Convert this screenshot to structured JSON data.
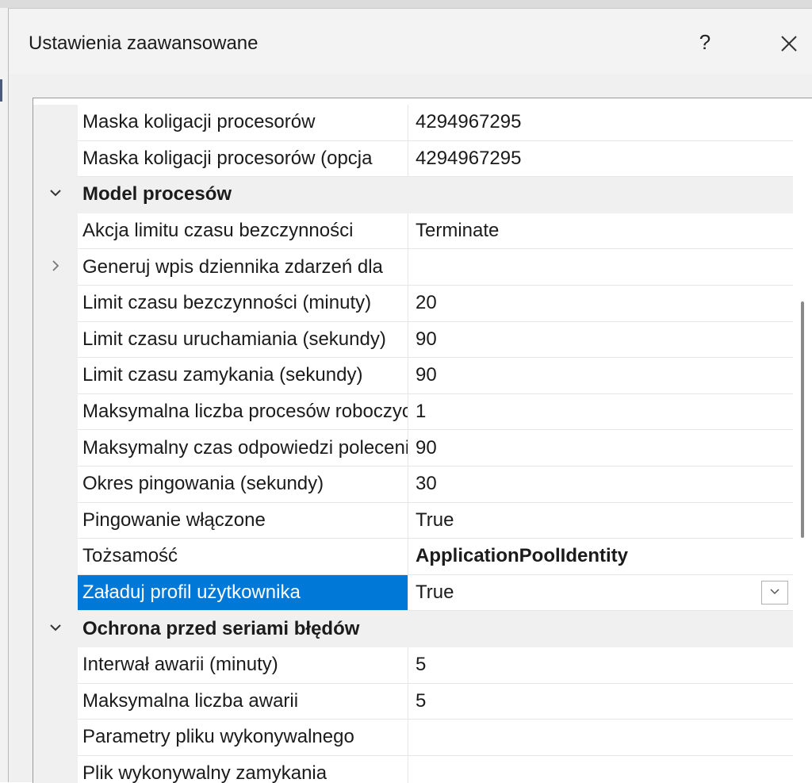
{
  "dialog": {
    "title": "Ustawienia zaawansowane",
    "help_label": "?"
  },
  "properties": [
    {
      "type": "item",
      "name": "Maska koligacji procesorów",
      "value": "4294967295"
    },
    {
      "type": "item",
      "name": "Maska koligacji procesorów (opcja",
      "value": "4294967295"
    },
    {
      "type": "category",
      "name": "Model procesów",
      "expanded": true
    },
    {
      "type": "item",
      "name": "Akcja limitu czasu bezczynności",
      "value": "Terminate"
    },
    {
      "type": "item",
      "name": "Generuj wpis dziennika zdarzeń dla",
      "value": "",
      "expandable": true
    },
    {
      "type": "item",
      "name": "Limit czasu bezczynności (minuty)",
      "value": "20"
    },
    {
      "type": "item",
      "name": "Limit czasu uruchamiania (sekundy)",
      "value": "90"
    },
    {
      "type": "item",
      "name": "Limit czasu zamykania (sekundy)",
      "value": "90"
    },
    {
      "type": "item",
      "name": "Maksymalna liczba procesów roboczych",
      "value": "1"
    },
    {
      "type": "item",
      "name": "Maksymalny czas odpowiedzi polecenia ping",
      "value": "90"
    },
    {
      "type": "item",
      "name": "Okres pingowania (sekundy)",
      "value": "30"
    },
    {
      "type": "item",
      "name": "Pingowanie włączone",
      "value": "True"
    },
    {
      "type": "item",
      "name": "Tożsamość",
      "value": "ApplicationPoolIdentity",
      "bold": true
    },
    {
      "type": "item",
      "name": "Załaduj profil użytkownika",
      "value": "True",
      "selected": true
    },
    {
      "type": "category",
      "name": "Ochrona przed seriami błędów",
      "expanded": true
    },
    {
      "type": "item",
      "name": "Interwał awarii (minuty)",
      "value": "5"
    },
    {
      "type": "item",
      "name": "Maksymalna liczba awarii",
      "value": "5"
    },
    {
      "type": "item",
      "name": "Parametry pliku wykonywalnego",
      "value": ""
    },
    {
      "type": "item",
      "name": "Plik wykonywalny zamykania",
      "value": ""
    }
  ],
  "colors": {
    "selection": "#0078d7",
    "category_background": "#f0f0f0"
  }
}
